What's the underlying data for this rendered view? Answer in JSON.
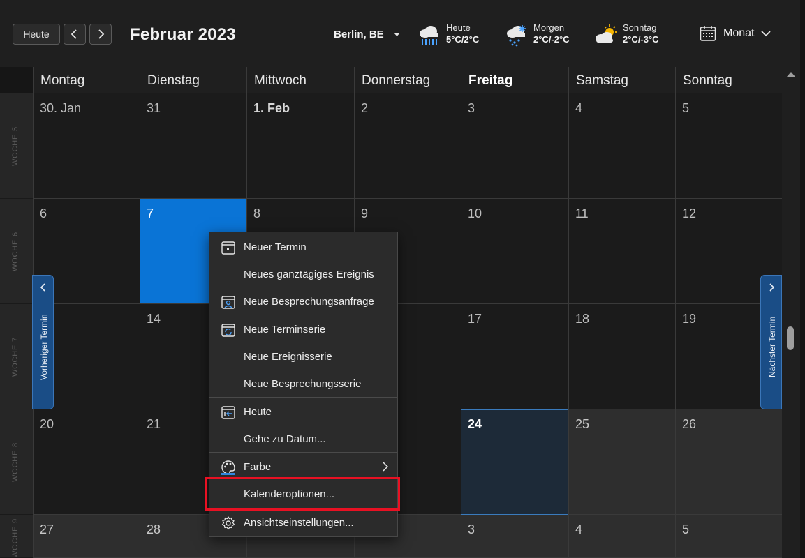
{
  "header": {
    "today_button": "Heute",
    "month_title": "Februar 2023",
    "location": "Berlin, BE",
    "weather": [
      {
        "label": "Heute",
        "temp": "5°C/2°C",
        "icon": "rain-cloud-icon"
      },
      {
        "label": "Morgen",
        "temp": "2°C/-2°C",
        "icon": "snow-cloud-icon"
      },
      {
        "label": "Sonntag",
        "temp": "2°C/-3°C",
        "icon": "partly-sunny-icon"
      }
    ],
    "view_label": "Monat"
  },
  "weekdays": [
    "Montag",
    "Dienstag",
    "Mittwoch",
    "Donnerstag",
    "Freitag",
    "Samstag",
    "Sonntag"
  ],
  "weeks": [
    {
      "label": "WOCHE 5",
      "days": [
        "30. Jan",
        "31",
        "1. Feb",
        "2",
        "3",
        "4",
        "5"
      ]
    },
    {
      "label": "WOCHE 6",
      "days": [
        "6",
        "7",
        "8",
        "9",
        "10",
        "11",
        "12"
      ]
    },
    {
      "label": "WOCHE 7",
      "days": [
        "",
        "14",
        "",
        "",
        "17",
        "18",
        "19"
      ]
    },
    {
      "label": "WOCHE 8",
      "days": [
        "20",
        "21",
        "",
        "",
        "24",
        "25",
        "26"
      ]
    },
    {
      "label": "WOCHE 9",
      "days": [
        "27",
        "28",
        "",
        "",
        "3",
        "4",
        "5"
      ]
    }
  ],
  "side_tabs": {
    "previous": "Vorheriger Termin",
    "next": "Nächster Termin"
  },
  "context_menu": {
    "items": [
      {
        "label": "Neuer Termin",
        "icon": "calendar-new-icon"
      },
      {
        "label": "Neues ganztägiges Ereignis",
        "icon": ""
      },
      {
        "label": "Neue Besprechungsanfrage",
        "icon": "meeting-request-icon"
      },
      {
        "label": "Neue Terminserie",
        "icon": "recurring-appointment-icon"
      },
      {
        "label": "Neue Ereignisserie",
        "icon": ""
      },
      {
        "label": "Neue Besprechungsserie",
        "icon": ""
      },
      {
        "label": "Heute",
        "icon": "calendar-today-icon"
      },
      {
        "label": "Gehe zu Datum...",
        "icon": ""
      },
      {
        "label": "Farbe",
        "icon": "palette-icon"
      },
      {
        "label": "Kalenderoptionen...",
        "icon": ""
      },
      {
        "label": "Ansichtseinstellungen...",
        "icon": "gear-icon"
      }
    ]
  },
  "colors": {
    "accent": "#0a74d6",
    "today_bg": "#1d2a38",
    "side_tab": "#1a4d86",
    "highlight": "#e81123"
  }
}
